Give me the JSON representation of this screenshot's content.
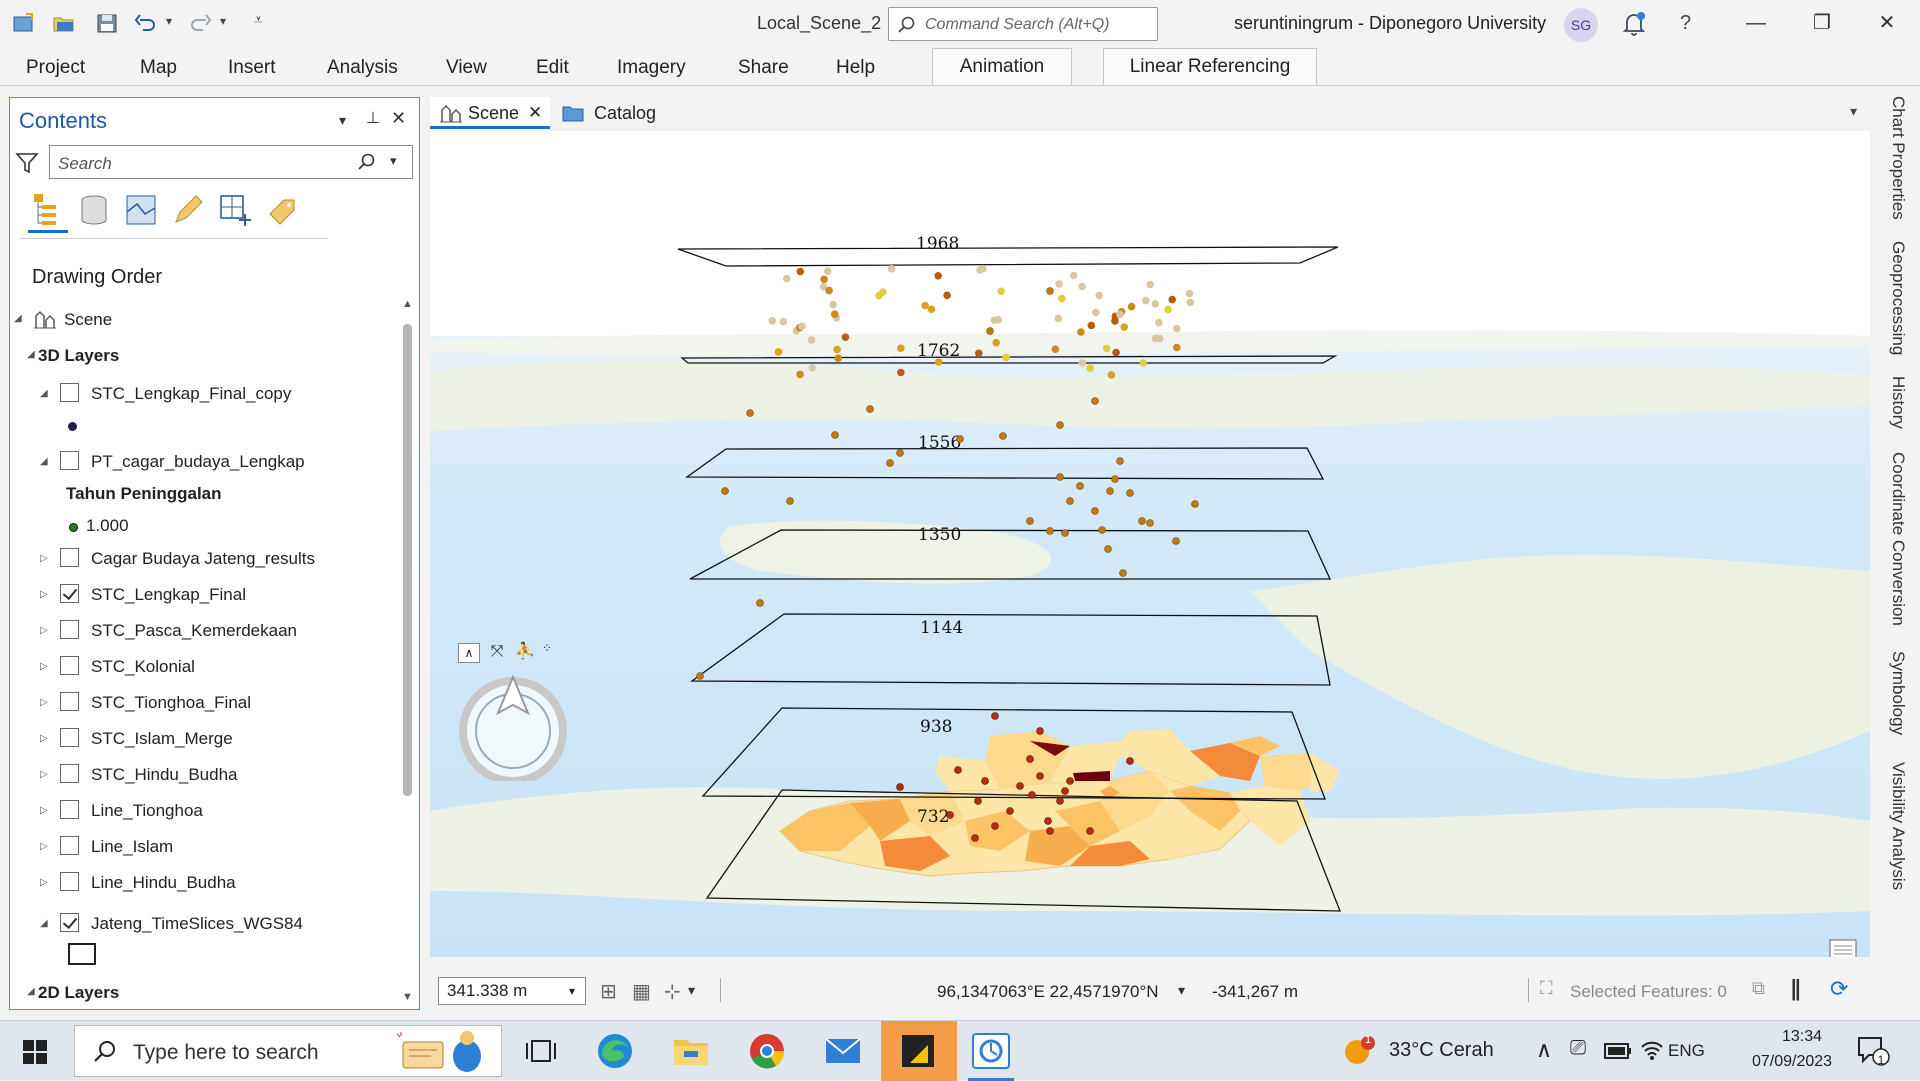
{
  "titlebar": {
    "doc_title": "Local_Scene_2",
    "command_search_placeholder": "Command Search (Alt+Q)",
    "user": "seruntiningrum - Diponegoro University",
    "avatar_initials": "SG",
    "help": "?"
  },
  "ribbon": {
    "tabs": [
      "Project",
      "Map",
      "Insert",
      "Analysis",
      "View",
      "Edit",
      "Imagery",
      "Share",
      "Help"
    ],
    "context_tabs": [
      "Animation",
      "Linear Referencing"
    ]
  },
  "contents": {
    "title": "Contents",
    "search_placeholder": "Search",
    "drawing_order": "Drawing Order",
    "scene": "Scene",
    "group_3d": "3D Layers",
    "group_2d": "2D Layers",
    "layer_stl_copy": "STC_Lengkap_Final_copy",
    "layer_pt": "PT_cagar_budaya_Lengkap",
    "legend_heading": "Tahun Peninggalan",
    "legend_value": "1.000",
    "layers": [
      {
        "label": "Cagar Budaya Jateng_results",
        "checked": false
      },
      {
        "label": "STC_Lengkap_Final",
        "checked": true
      },
      {
        "label": "STC_Pasca_Kemerdekaan",
        "checked": false
      },
      {
        "label": "STC_Kolonial",
        "checked": false
      },
      {
        "label": "STC_Tionghoa_Final",
        "checked": false
      },
      {
        "label": "STC_Islam_Merge",
        "checked": false
      },
      {
        "label": "STC_Hindu_Budha",
        "checked": false
      },
      {
        "label": "Line_Tionghoa",
        "checked": false
      },
      {
        "label": "Line_Islam",
        "checked": false
      },
      {
        "label": "Line_Hindu_Budha",
        "checked": false
      }
    ],
    "layer_timeslices": "Jateng_TimeSlices_WGS84"
  },
  "views": {
    "scene_tab": "Scene",
    "catalog_tab": "Catalog"
  },
  "scene": {
    "slice_labels": [
      "1968",
      "1762",
      "1556",
      "1350",
      "1144",
      "938",
      "732"
    ]
  },
  "status": {
    "scale": "341.338 m",
    "coords": "96,1347063°E 22,4571970°N",
    "elevation": "-341,267 m",
    "selected": "Selected Features: 0"
  },
  "side_tabs": [
    "Chart Properties",
    "Geoprocessing",
    "History",
    "Coordinate Conversion",
    "Symbology",
    "Visibility Analysis"
  ],
  "taskbar": {
    "search_placeholder": "Type here to search",
    "weather": "33°C  Cerah",
    "weather_badge": "1",
    "lang": "ENG",
    "time": "13:34",
    "date": "07/09/2023",
    "notif_count": "1"
  },
  "colors": {
    "accent": "#1a5aa6",
    "slice_outline": "#111111"
  }
}
